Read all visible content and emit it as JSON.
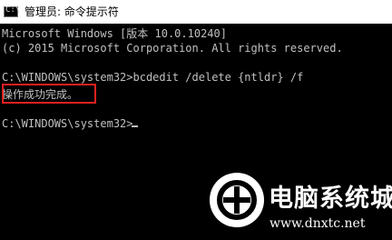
{
  "window": {
    "title": "管理员: 命令提示符",
    "icon": "cmd-icon"
  },
  "console": {
    "lines": [
      "Microsoft Windows [版本 10.0.10240]",
      "(c) 2015 Microsoft Corporation. All rights reserved.",
      "",
      "C:\\WINDOWS\\system32>bcdedit /delete {ntldr} /f",
      "操作成功完成。",
      "",
      "C:\\WINDOWS\\system32>"
    ]
  },
  "watermark": {
    "brand": "电脑系统城",
    "url": "www.dnxtc.net"
  },
  "colors": {
    "console_text": "#c0c0c0",
    "console_bg": "#000000",
    "highlight_box": "#e02020"
  }
}
